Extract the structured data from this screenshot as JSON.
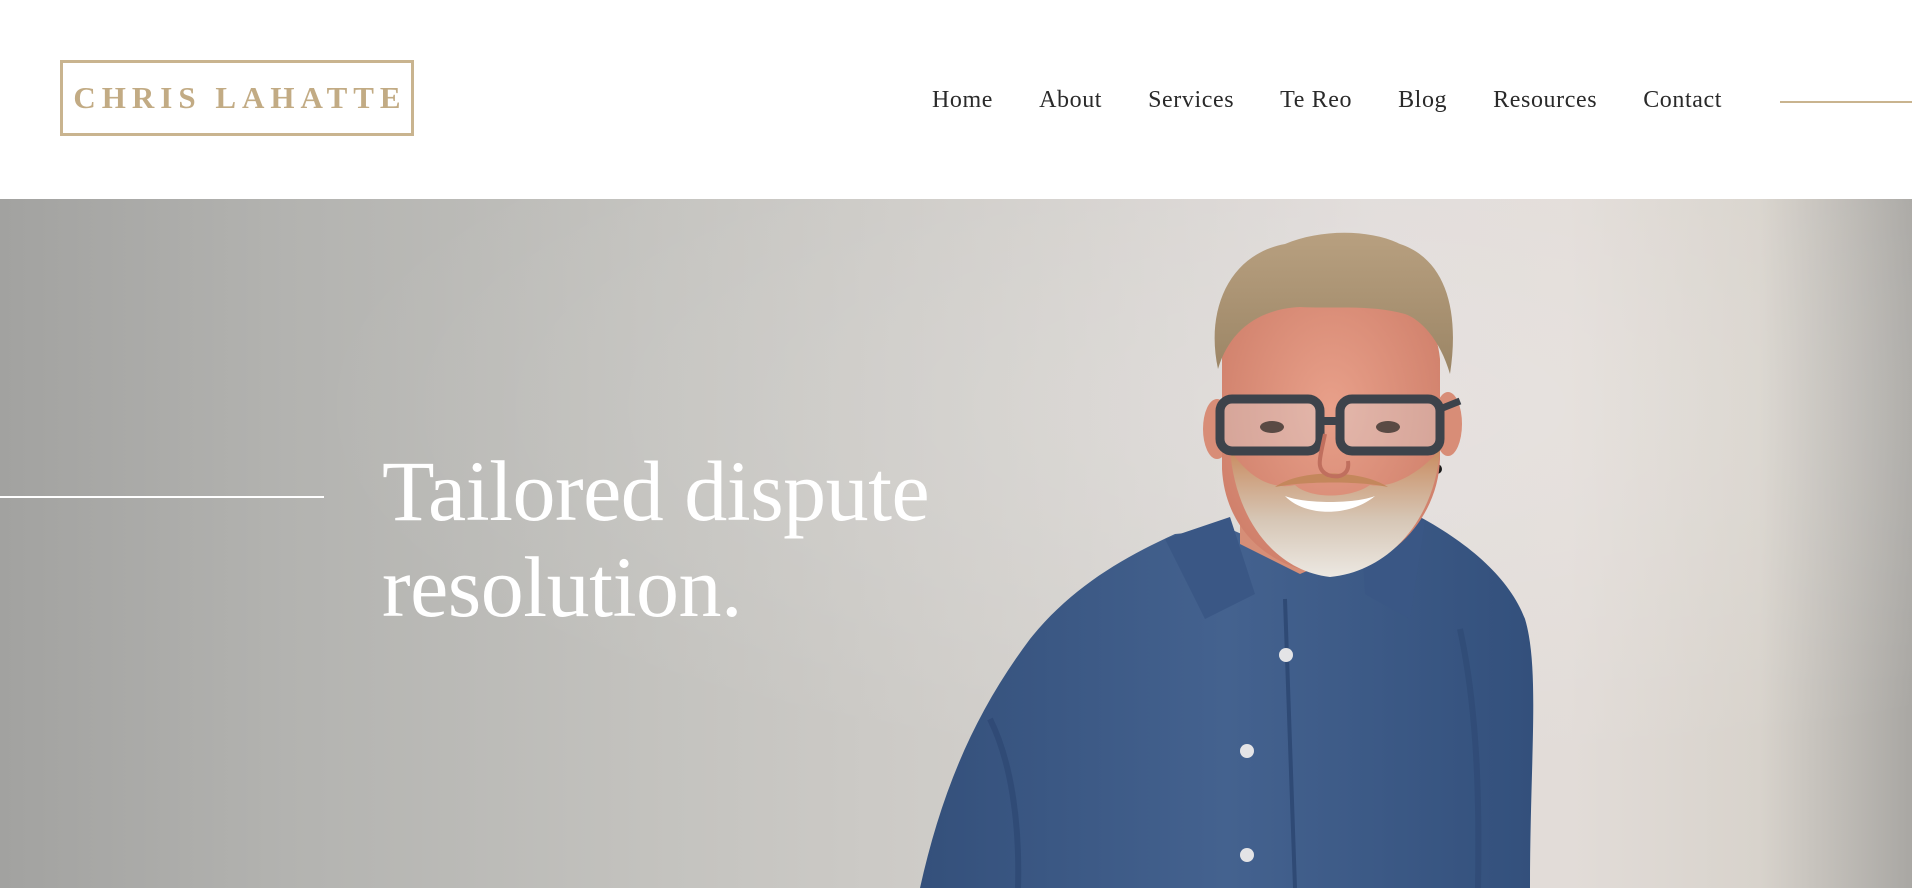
{
  "header": {
    "logo_text": "CHRIS LAHATTE",
    "nav": [
      {
        "label": "Home"
      },
      {
        "label": "About"
      },
      {
        "label": "Services"
      },
      {
        "label": "Te Reo"
      },
      {
        "label": "Blog"
      },
      {
        "label": "Resources"
      },
      {
        "label": "Contact"
      }
    ]
  },
  "hero": {
    "heading_line1": "Tailored dispute",
    "heading_line2": "resolution."
  },
  "colors": {
    "accent_gold": "#c9b48f",
    "nav_text": "#2a2a2a",
    "hero_text": "#ffffff",
    "shirt_blue": "#3e5a87"
  }
}
